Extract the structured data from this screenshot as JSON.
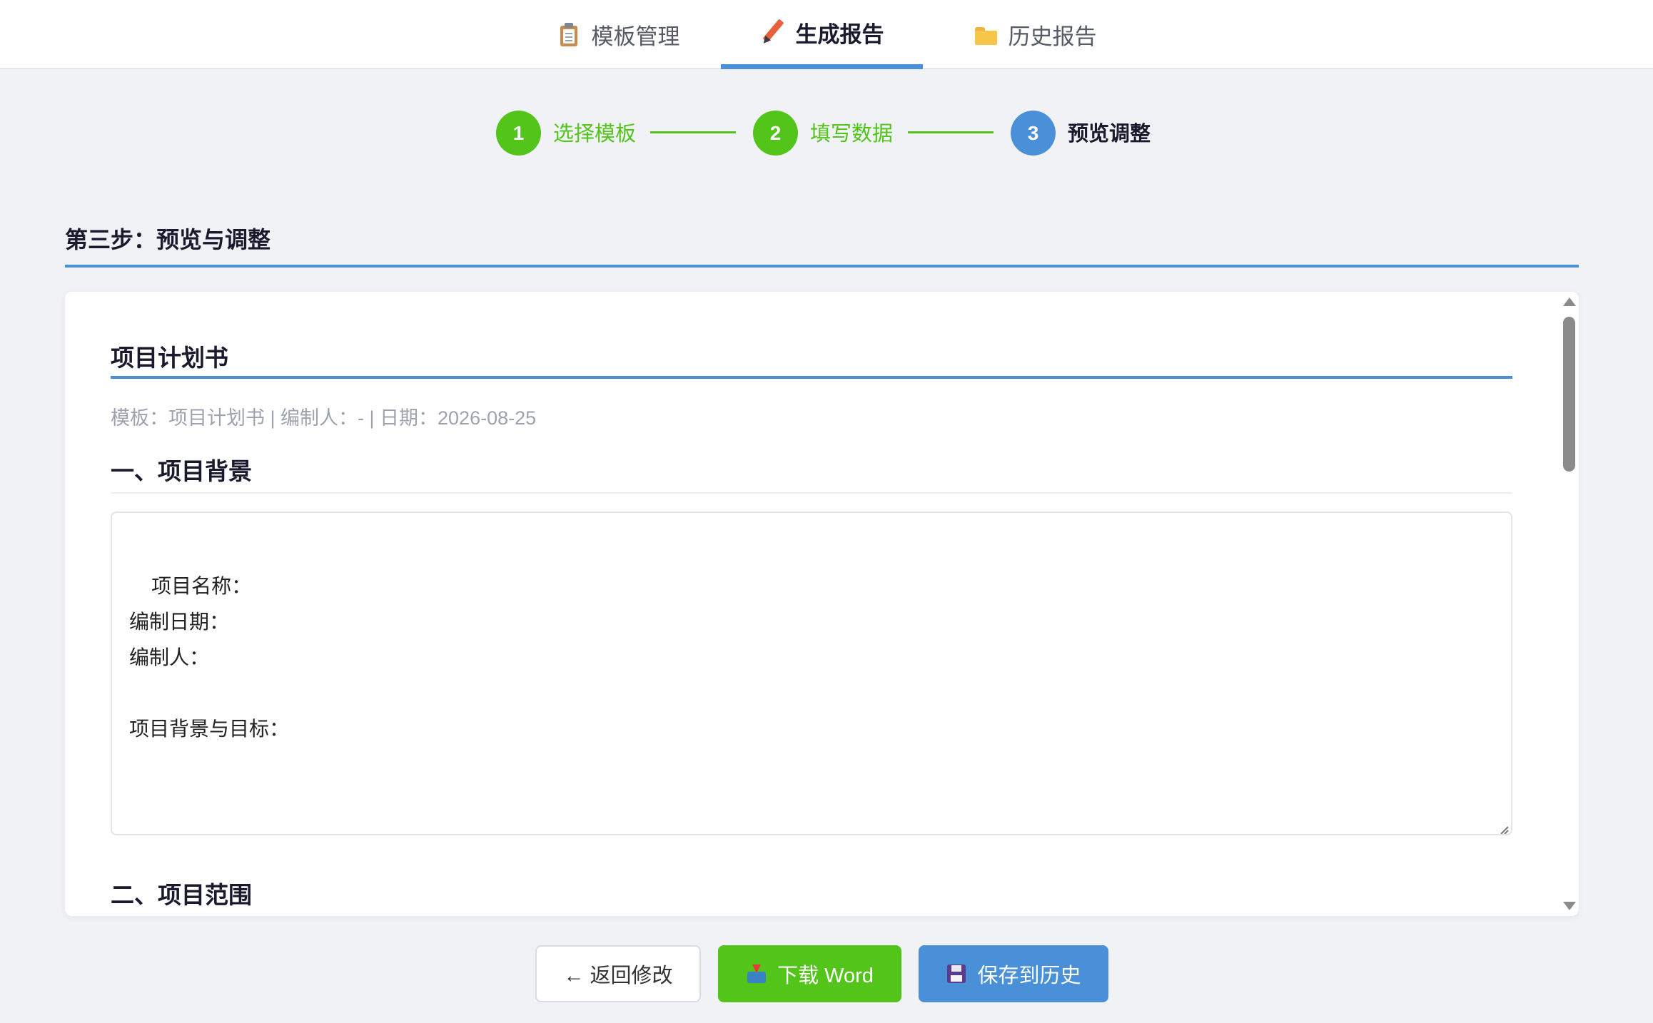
{
  "nav": {
    "tabs": [
      {
        "label": "模板管理",
        "icon": "clipboard-icon",
        "active": false
      },
      {
        "label": "生成报告",
        "icon": "pencil-icon",
        "active": true
      },
      {
        "label": "历史报告",
        "icon": "folder-icon",
        "active": false
      }
    ]
  },
  "stepper": {
    "steps": [
      {
        "number": "1",
        "label": "选择模板",
        "status": "done"
      },
      {
        "number": "2",
        "label": "填写数据",
        "status": "done"
      },
      {
        "number": "3",
        "label": "预览调整",
        "status": "current"
      }
    ],
    "colors": {
      "done": "#52c41a",
      "current": "#4a90d9"
    }
  },
  "section": {
    "title": "第三步：预览与调整"
  },
  "preview": {
    "doc_title": "项目计划书",
    "meta": "模板：项目计划书 | 编制人：- | 日期：2026-08-25",
    "sections": [
      {
        "heading": "一、项目背景",
        "content": "项目名称：\n编制日期：\n编制人：\n\n项目背景与目标："
      },
      {
        "heading": "二、项目范围"
      }
    ]
  },
  "actions": {
    "back_label": "← 返回修改",
    "download_label": "下载 Word",
    "save_label": "保存到历史"
  },
  "colors": {
    "primary": "#4a90d9",
    "success": "#52c41a",
    "background": "#f0f2f5"
  }
}
